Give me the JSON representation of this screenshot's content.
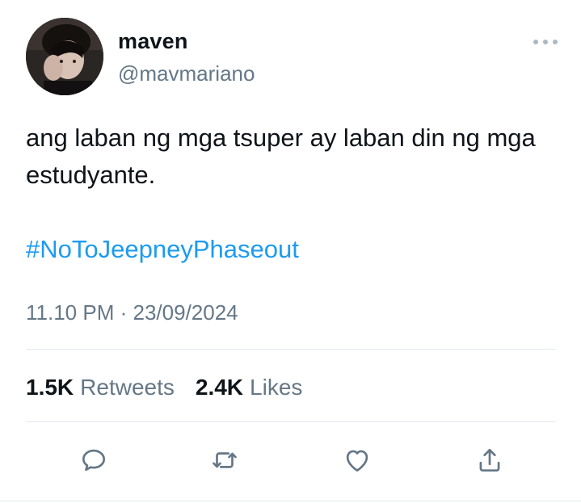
{
  "user": {
    "display_name": "maven",
    "handle": "@mavmariano"
  },
  "tweet": {
    "text": "ang laban ng mga tsuper ay laban din ng mga estudyante.",
    "hashtag": "#NoToJeepneyPhaseout",
    "time": "11.10 PM",
    "separator": "·",
    "date": "23/09/2024"
  },
  "stats": {
    "retweets_count": "1.5K",
    "retweets_label": "Retweets",
    "likes_count": "2.4K",
    "likes_label": "Likes"
  },
  "icons": {
    "more": "more-dots-icon",
    "reply": "reply-icon",
    "retweet": "retweet-icon",
    "like": "heart-icon",
    "share": "share-icon"
  },
  "colors": {
    "hashtag": "#1d9bf0",
    "secondary_text": "#657786",
    "primary_text": "#0f1419",
    "divider": "#e1e8ed"
  }
}
